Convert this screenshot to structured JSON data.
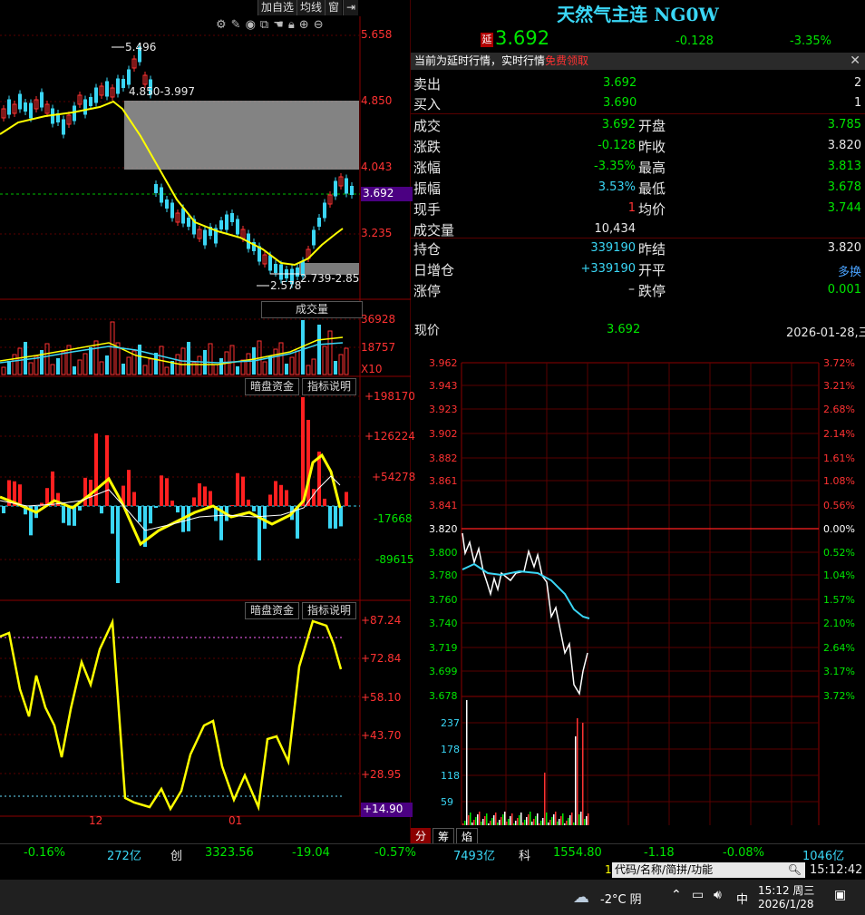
{
  "toolbar": {
    "add_watch": "加自选",
    "avg_line": "均线",
    "window": "窗"
  },
  "kline": {
    "price_axis": [
      "5.658",
      "4.850",
      "4.043",
      "3.692",
      "3.235"
    ],
    "high_note": "5.496",
    "range_top_note": "4.850-3.997",
    "range_bottom_note": "2.739-2.85",
    "low_note": "2.578"
  },
  "volume_panel": {
    "title": "成交量",
    "axis": [
      "36928",
      "18757"
    ],
    "unit": "X10"
  },
  "fund_panel1": {
    "btn1": "暗盘资金",
    "btn2": "指标说明",
    "axis": [
      "+198170",
      "+126224",
      "+54278",
      "-17668",
      "-89615"
    ]
  },
  "fund_panel2": {
    "btn1": "暗盘资金",
    "btn2": "指标说明",
    "axis": [
      "+87.24",
      "+72.84",
      "+58.10",
      "+43.70",
      "+28.95",
      "+14.90"
    ]
  },
  "date_axis": [
    "12",
    "01"
  ],
  "quote": {
    "title": "天然气主连 NG0W",
    "delay_badge": "延",
    "price": "3.692",
    "change": "-0.128",
    "change_pct": "-3.35%",
    "notice": "当前为延时行情，实时行情",
    "notice_link": "免费领取",
    "sell_label": "卖出",
    "sell_price": "3.692",
    "sell_vol": "2",
    "buy_label": "买入",
    "buy_price": "3.690",
    "buy_vol": "1",
    "rows": [
      {
        "l1": "成交",
        "v1": "3.692",
        "l2": "开盘",
        "v2": "3.785"
      },
      {
        "l1": "涨跌",
        "v1": "-0.128",
        "l2": "昨收",
        "v2": "3.820"
      },
      {
        "l1": "涨幅",
        "v1": "-3.35%",
        "l2": "最高",
        "v2": "3.813"
      },
      {
        "l1": "振幅",
        "v1": "3.53%",
        "l2": "最低",
        "v2": "3.678"
      },
      {
        "l1": "现手",
        "v1": "1",
        "l2": "均价",
        "v2": "3.744"
      },
      {
        "l1": "成交量",
        "v1": "10,434",
        "l2": "",
        "v2": ""
      }
    ],
    "rows2": [
      {
        "l1": "持仓",
        "v1": "339190",
        "l2": "昨结",
        "v2": "3.820"
      },
      {
        "l1": "日增仓",
        "v1": "+339190",
        "l2": "开平",
        "v2": "多换"
      },
      {
        "l1": "涨停",
        "v1": "",
        "l2": "跌停",
        "v2": "0.001"
      }
    ]
  },
  "intraday": {
    "label": "现价",
    "price": "3.692",
    "date": "2026-01-28,三",
    "price_axis": [
      "3.962",
      "3.943",
      "3.923",
      "3.902",
      "3.882",
      "3.861",
      "3.841",
      "3.820",
      "3.800",
      "3.780",
      "3.760",
      "3.740",
      "3.719",
      "3.699",
      "3.678"
    ],
    "pct_axis": [
      "3.72%",
      "3.21%",
      "2.68%",
      "2.14%",
      "1.61%",
      "1.08%",
      "0.56%",
      "0.00%",
      "0.52%",
      "1.04%",
      "1.57%",
      "2.10%",
      "2.64%",
      "3.17%",
      "3.72%"
    ],
    "vol_axis": [
      "237",
      "178",
      "118",
      "59"
    ],
    "tabs": [
      "分",
      "筹",
      "焰"
    ]
  },
  "status": {
    "s1": "-0.16%",
    "s2": "272亿",
    "s3": "创",
    "s4": "3323.56",
    "s5": "-19.04",
    "s6": "-0.57%",
    "s7": "7493亿",
    "s8": "科",
    "s9": "1554.80",
    "s10": "-1.18",
    "s11": "-0.08%",
    "s12": "1046亿"
  },
  "cmd": {
    "num": "1",
    "placeholder": "代码/名称/简拼/功能",
    "clock": "15:12:42"
  },
  "taskbar": {
    "weather": "-2°C 阴",
    "ime": "中",
    "time": "15:12 周三",
    "date": "2026/1/28"
  }
}
